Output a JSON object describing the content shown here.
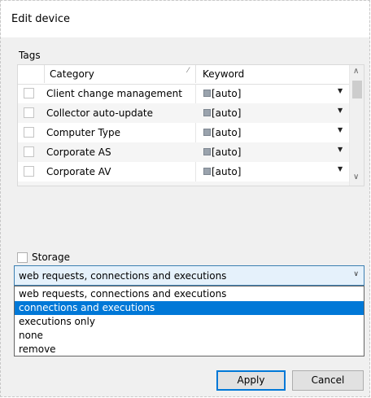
{
  "dialog": {
    "title": "Edit device"
  },
  "tags": {
    "label": "Tags",
    "columns": {
      "category": "Category",
      "keyword": "Keyword",
      "sort_icon": "sort-indicator-icon"
    },
    "rows": [
      {
        "category": "Client change management",
        "keyword": "[auto]"
      },
      {
        "category": "Collector auto-update",
        "keyword": "[auto]"
      },
      {
        "category": "Computer Type",
        "keyword": "[auto]"
      },
      {
        "category": "Corporate AS",
        "keyword": "[auto]"
      },
      {
        "category": "Corporate AV",
        "keyword": "[auto]"
      }
    ]
  },
  "storage": {
    "label": "Storage",
    "checked": false,
    "selected_value": "web requests, connections and executions",
    "options": [
      "web requests, connections and executions",
      "connections and executions",
      "executions only",
      "none",
      "remove"
    ],
    "highlighted_option": "connections and executions"
  },
  "buttons": {
    "apply": "Apply",
    "cancel": "Cancel"
  },
  "colors": {
    "selection": "#0078d7",
    "combo_bg": "#e5f1fb",
    "dialog_bg": "#f0f0f0"
  }
}
